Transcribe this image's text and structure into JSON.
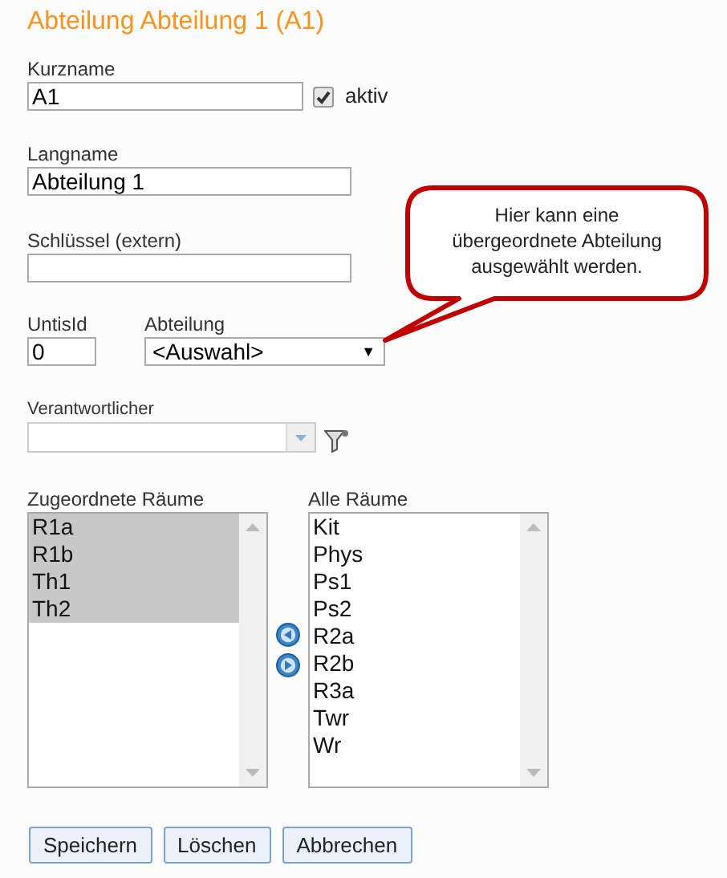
{
  "title": "Abteilung Abteilung 1 (A1)",
  "kurzname": {
    "label": "Kurzname",
    "value": "A1"
  },
  "aktiv": {
    "label": "aktiv",
    "checked": true
  },
  "langname": {
    "label": "Langname",
    "value": "Abteilung 1"
  },
  "schluessel": {
    "label": "Schlüssel (extern)"
  },
  "untisid": {
    "label": "UntisId",
    "value": "0"
  },
  "abteilung": {
    "label": "Abteilung",
    "value": "<Auswahl>",
    "arrow": "▼"
  },
  "verantwortlicher": {
    "label": "Verantwortlicher"
  },
  "callout": {
    "text": "Hier kann eine übergeordnete Abteilung ausgewählt werden."
  },
  "assigned_rooms": {
    "label": "Zugeordnete Räume",
    "items": [
      {
        "name": "R1a",
        "selected": true
      },
      {
        "name": "R1b",
        "selected": true
      },
      {
        "name": "Th1",
        "selected": true
      },
      {
        "name": "Th2",
        "selected": true
      }
    ]
  },
  "all_rooms": {
    "label": "Alle Räume",
    "items": [
      {
        "name": "Kit",
        "selected": false
      },
      {
        "name": "Phys",
        "selected": false
      },
      {
        "name": "Ps1",
        "selected": false
      },
      {
        "name": "Ps2",
        "selected": false
      },
      {
        "name": "R2a",
        "selected": false
      },
      {
        "name": "R2b",
        "selected": false
      },
      {
        "name": "R3a",
        "selected": false
      },
      {
        "name": "Twr",
        "selected": false
      },
      {
        "name": "Wr",
        "selected": false
      }
    ]
  },
  "buttons": [
    "Speichern",
    "Löschen",
    "Abbrechen"
  ]
}
